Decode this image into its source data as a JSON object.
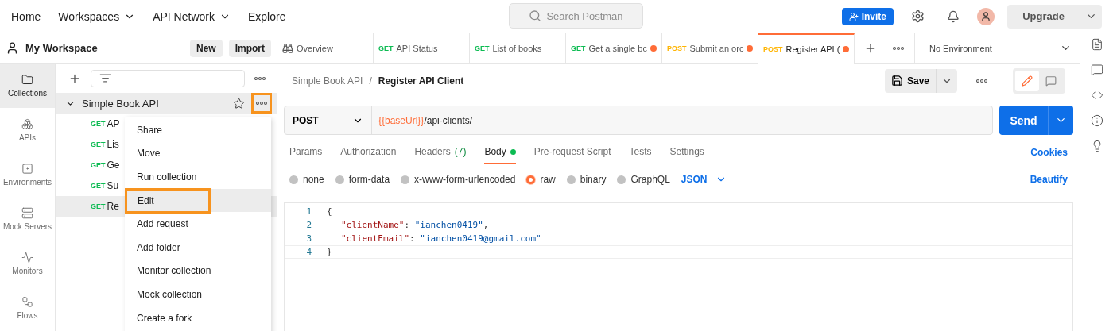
{
  "top_nav": {
    "items": [
      {
        "label": "Home",
        "dropdown": false
      },
      {
        "label": "Workspaces",
        "dropdown": true
      },
      {
        "label": "API Network",
        "dropdown": true
      },
      {
        "label": "Explore",
        "dropdown": false
      }
    ],
    "search": {
      "placeholder": "Search Postman"
    },
    "invite": "Invite",
    "upgrade": "Upgrade"
  },
  "workspace": {
    "name": "My Workspace",
    "buttons": [
      "New",
      "Import"
    ]
  },
  "side_nav": [
    {
      "label": "Collections",
      "selected": true
    },
    {
      "label": "APIs",
      "selected": false
    },
    {
      "label": "Environments",
      "selected": false
    },
    {
      "label": "Mock Servers",
      "selected": false
    },
    {
      "label": "Monitors",
      "selected": false
    },
    {
      "label": "Flows",
      "selected": false
    }
  ],
  "collection": {
    "name": "Simple Book API",
    "expanded": true,
    "requests": [
      {
        "method": "GET",
        "name": "AP",
        "selected": false
      },
      {
        "method": "GET",
        "name": "Lis",
        "selected": false
      },
      {
        "method": "GET",
        "name": "Ge",
        "selected": false
      },
      {
        "method": "GET",
        "name": "Su",
        "selected": false
      },
      {
        "method": "GET",
        "name": "Re",
        "selected": true
      }
    ]
  },
  "context_menu": [
    {
      "label": "Share",
      "highlighted": false
    },
    {
      "label": "Move",
      "highlighted": false
    },
    {
      "label": "Run collection",
      "highlighted": false
    },
    {
      "label": "Edit",
      "highlighted": true
    },
    {
      "label": "Add request",
      "highlighted": false
    },
    {
      "label": "Add folder",
      "highlighted": false
    },
    {
      "label": "Monitor collection",
      "highlighted": false
    },
    {
      "label": "Mock collection",
      "highlighted": false
    },
    {
      "label": "Create a fork",
      "highlighted": false
    }
  ],
  "tabs": [
    {
      "kind": "overview",
      "title": "Overview",
      "unsaved": false,
      "selected": false
    },
    {
      "kind": "request",
      "method": "GET",
      "title": "API Status",
      "unsaved": false,
      "selected": false
    },
    {
      "kind": "request",
      "method": "GET",
      "title": "List of books",
      "unsaved": false,
      "selected": false
    },
    {
      "kind": "request",
      "method": "GET",
      "title": "Get a single bc",
      "unsaved": true,
      "selected": false
    },
    {
      "kind": "request",
      "method": "POST",
      "title": "Submit an orc",
      "unsaved": true,
      "selected": false
    },
    {
      "kind": "request",
      "method": "POST",
      "title": "Register API (",
      "unsaved": true,
      "selected": true
    }
  ],
  "environment": "No Environment",
  "breadcrumb": {
    "parent": "Simple Book API",
    "separator": "/",
    "current": "Register API Client"
  },
  "save": "Save",
  "request": {
    "method": "POST",
    "url_variable": "{{baseUrl}}",
    "url_path": "/api-clients/",
    "send": "Send"
  },
  "request_tabs": [
    {
      "label": "Params",
      "dot": false,
      "selected": false
    },
    {
      "label": "Authorization",
      "dot": false,
      "selected": false
    },
    {
      "label": "Headers",
      "badge": "(7)",
      "dot": false,
      "selected": false
    },
    {
      "label": "Body",
      "dot": true,
      "selected": true
    },
    {
      "label": "Pre-request Script",
      "dot": false,
      "selected": false
    },
    {
      "label": "Tests",
      "dot": false,
      "selected": false
    },
    {
      "label": "Settings",
      "dot": false,
      "selected": false
    }
  ],
  "cookies": "Cookies",
  "body_types": [
    {
      "label": "none",
      "selected": false
    },
    {
      "label": "form-data",
      "selected": false
    },
    {
      "label": "x-www-form-urlencoded",
      "selected": false
    },
    {
      "label": "raw",
      "selected": true
    },
    {
      "label": "binary",
      "selected": false
    },
    {
      "label": "GraphQL",
      "selected": false
    }
  ],
  "format": "JSON",
  "beautify": "Beautify",
  "code_lines": [
    {
      "number": "1",
      "tokens": [
        {
          "kind": "punct",
          "text": "{"
        }
      ]
    },
    {
      "number": "2",
      "tokens": [
        {
          "kind": "key",
          "text": "\"clientName\""
        },
        {
          "kind": "punct",
          "text": ": "
        },
        {
          "kind": "string",
          "text": "\"ianchen0419\""
        },
        {
          "kind": "punct",
          "text": ","
        }
      ]
    },
    {
      "number": "3",
      "tokens": [
        {
          "kind": "key",
          "text": "\"clientEmail\""
        },
        {
          "kind": "punct",
          "text": ": "
        },
        {
          "kind": "string",
          "text": "\"ianchen0419@gmail.com\""
        }
      ]
    },
    {
      "number": "4",
      "tokens": [
        {
          "kind": "punct",
          "text": "}"
        }
      ]
    }
  ]
}
